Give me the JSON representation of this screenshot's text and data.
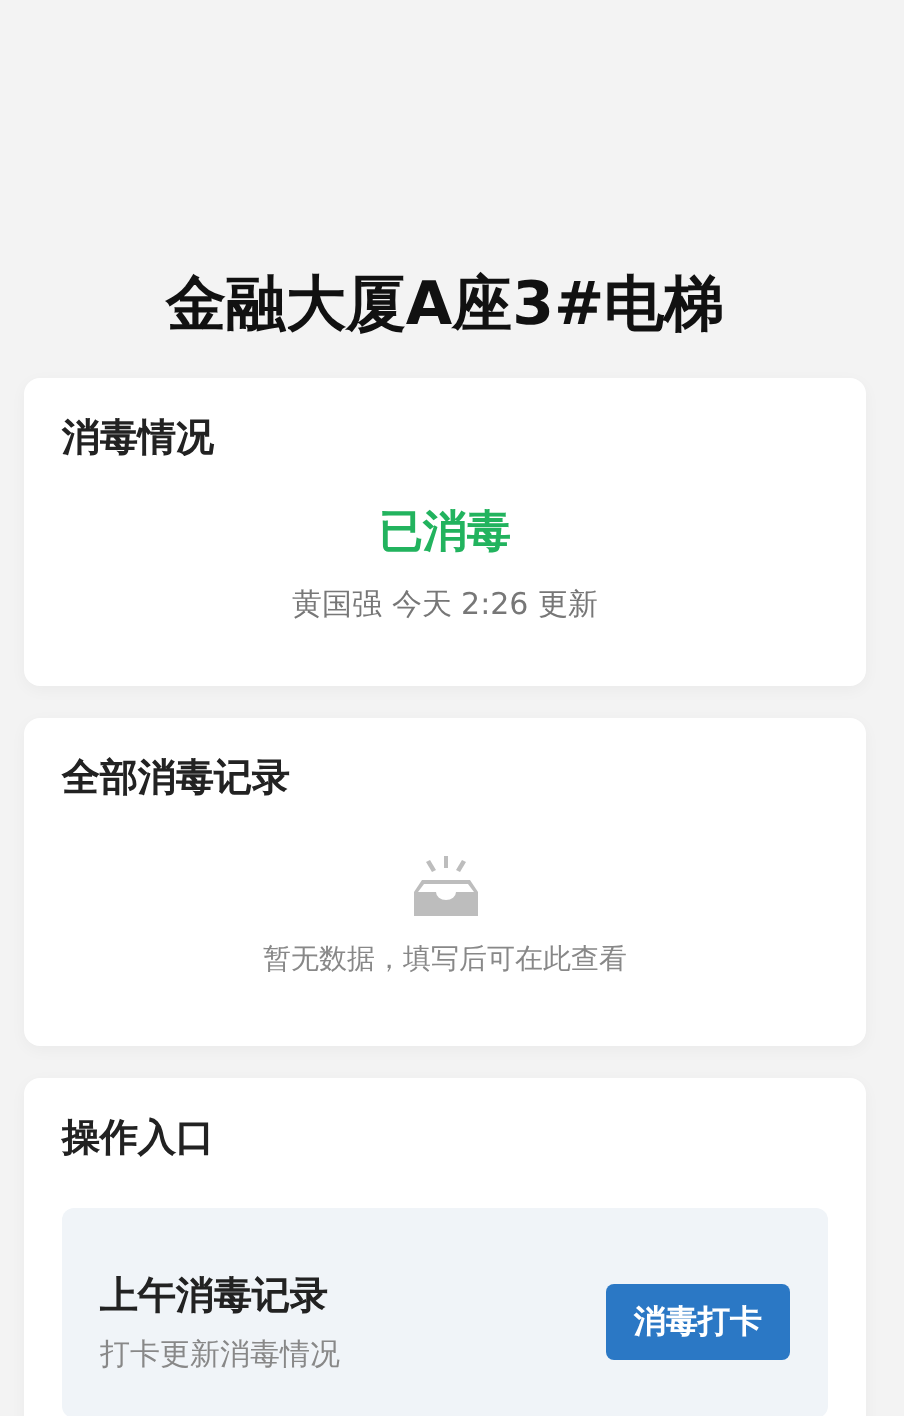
{
  "title": "金融大厦A座3#电梯",
  "status_card": {
    "heading": "消毒情况",
    "status": "已消毒",
    "disinfected": true,
    "updated": "黄国强 今天 2:26 更新"
  },
  "records_card": {
    "heading": "全部消毒记录",
    "empty_text": "暂无数据，填写后可在此查看"
  },
  "actions_card": {
    "heading": "操作入口",
    "items": [
      {
        "title": "上午消毒记录",
        "subtitle": "打卡更新消毒情况",
        "button": "消毒打卡"
      }
    ]
  }
}
